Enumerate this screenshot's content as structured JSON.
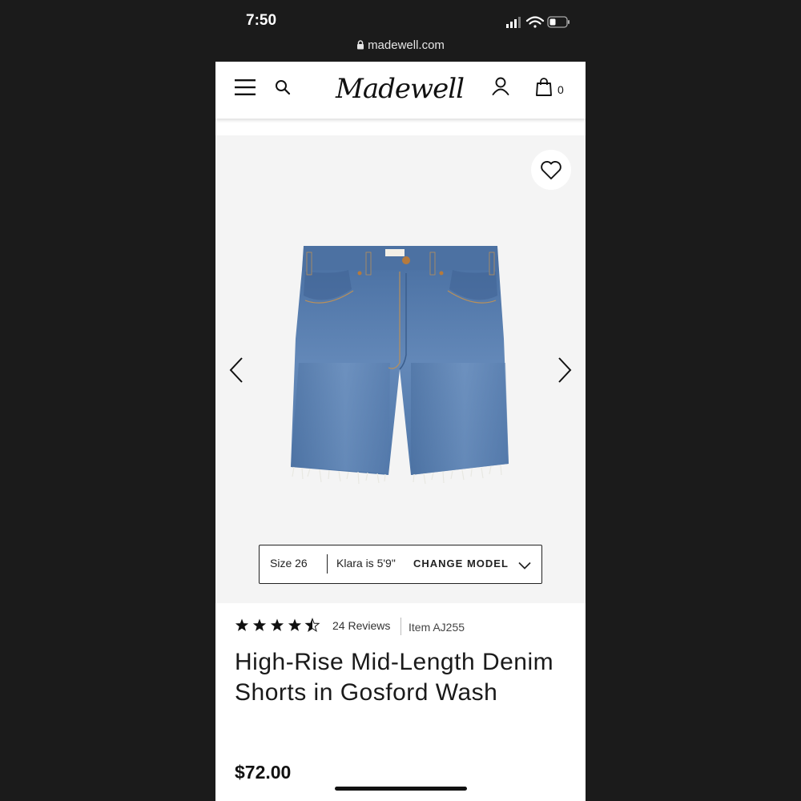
{
  "status_bar": {
    "time": "7:50"
  },
  "browser": {
    "url": "madewell.com"
  },
  "header": {
    "logo": "Madewell",
    "cart_count": "0"
  },
  "product": {
    "rating": 4.5,
    "reviews_label": "24 Reviews",
    "item_number": "Item AJ255",
    "title": "High-Rise Mid-Length Denim Shorts in Gosford Wash",
    "price": "$72.00"
  },
  "model_selector": {
    "size": "Size 26",
    "info": "Klara is 5'9\"",
    "change_label": "CHANGE MODEL"
  },
  "colors": {
    "background": "#1b1b1b",
    "gallery_bg": "#f4f4f4",
    "denim": "#5a7fae"
  }
}
